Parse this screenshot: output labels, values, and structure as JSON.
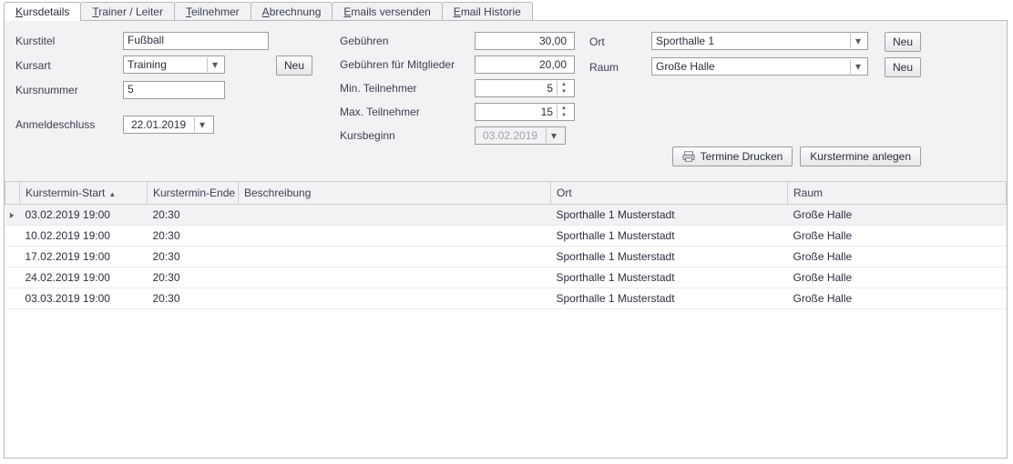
{
  "tabs": [
    "Kursdetails",
    "Trainer / Leiter",
    "Teilnehmer",
    "Abrechnung",
    "Emails versenden",
    "Email Historie"
  ],
  "activeTab": 0,
  "labels": {
    "kurstitel": "Kurstitel",
    "kursart": "Kursart",
    "kursnummer": "Kursnummer",
    "anmeldeschluss": "Anmeldeschluss",
    "gebuehren": "Gebühren",
    "gebuehren_mitglieder": "Gebühren für Mitglieder",
    "min_teilnehmer": "Min. Teilnehmer",
    "max_teilnehmer": "Max. Teilnehmer",
    "kursbeginn": "Kursbeginn",
    "ort": "Ort",
    "raum": "Raum"
  },
  "fields": {
    "kurstitel": "Fußball",
    "kursart": "Training",
    "kursnummer": "5",
    "anmeldeschluss": "22.01.2019",
    "gebuehren": "30,00",
    "gebuehren_mitglieder": "20,00",
    "min_teilnehmer": "5",
    "max_teilnehmer": "15",
    "kursbeginn": "03.02.2019",
    "ort": "Sporthalle 1",
    "raum": "Große Halle"
  },
  "buttons": {
    "neu": "Neu",
    "termine_drucken": "Termine Drucken",
    "kurstermine_anlegen": "Kurstermine anlegen"
  },
  "table": {
    "headers": [
      "Kurstermin-Start",
      "Kurstermin-Ende",
      "Beschreibung",
      "Ort",
      "Raum"
    ],
    "rows": [
      {
        "start": "03.02.2019 19:00",
        "ende": "20:30",
        "beschreibung": "",
        "ort": "Sporthalle 1 Musterstadt",
        "raum": "Große Halle"
      },
      {
        "start": "10.02.2019 19:00",
        "ende": "20:30",
        "beschreibung": "",
        "ort": "Sporthalle 1 Musterstadt",
        "raum": "Große Halle"
      },
      {
        "start": "17.02.2019 19:00",
        "ende": "20:30",
        "beschreibung": "",
        "ort": "Sporthalle 1 Musterstadt",
        "raum": "Große Halle"
      },
      {
        "start": "24.02.2019 19:00",
        "ende": "20:30",
        "beschreibung": "",
        "ort": "Sporthalle 1 Musterstadt",
        "raum": "Große Halle"
      },
      {
        "start": "03.03.2019 19:00",
        "ende": "20:30",
        "beschreibung": "",
        "ort": "Sporthalle 1 Musterstadt",
        "raum": "Große Halle"
      }
    ],
    "selected": 0
  }
}
